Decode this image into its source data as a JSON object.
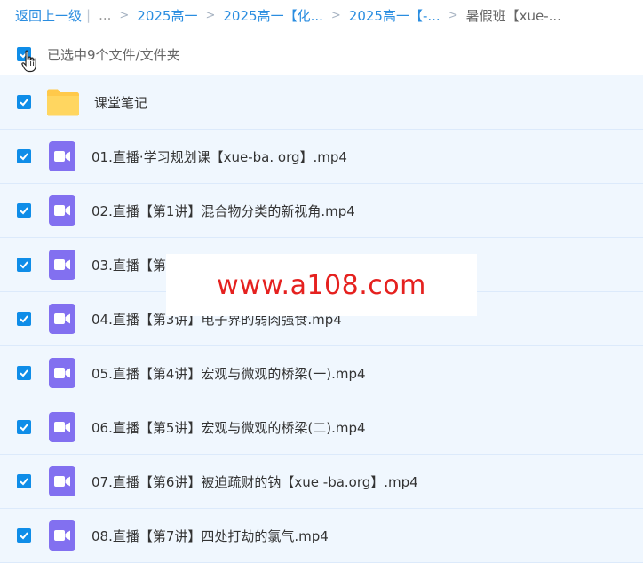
{
  "breadcrumb": {
    "back": "返回上一级",
    "sep": "|",
    "ellipsis": "...",
    "arrow": ">",
    "items": [
      "2025高一",
      "2025高一【化...",
      "2025高一【-..."
    ],
    "current": "暑假班【xue-..."
  },
  "selection": {
    "text": "已选中9个文件/文件夹"
  },
  "files": [
    {
      "name": "课堂笔记",
      "type": "folder"
    },
    {
      "name": "01.直播·学习规划课【xue-ba. org】.mp4",
      "type": "video"
    },
    {
      "name": "02.直播【第1讲】混合物分类的新视角.mp4",
      "type": "video"
    },
    {
      "name": "03.直播【第",
      "type": "video"
    },
    {
      "name": "04.直播【第3讲】电子界的弱肉强食.mp4",
      "type": "video"
    },
    {
      "name": "05.直播【第4讲】宏观与微观的桥梁(一).mp4",
      "type": "video"
    },
    {
      "name": "06.直播【第5讲】宏观与微观的桥梁(二).mp4",
      "type": "video"
    },
    {
      "name": "07.直播【第6讲】被迫疏财的钠【xue -ba.org】.mp4",
      "type": "video"
    },
    {
      "name": "08.直播【第7讲】四处打劫的氯气.mp4",
      "type": "video"
    }
  ],
  "watermark": "www.a108.com",
  "colors": {
    "link": "#2a8de0",
    "checkbox": "#0f8de8",
    "row_bg": "#f0f7fe",
    "video_icon": "#8270f0",
    "folder": "#ffc94a",
    "watermark": "#e5211f"
  }
}
